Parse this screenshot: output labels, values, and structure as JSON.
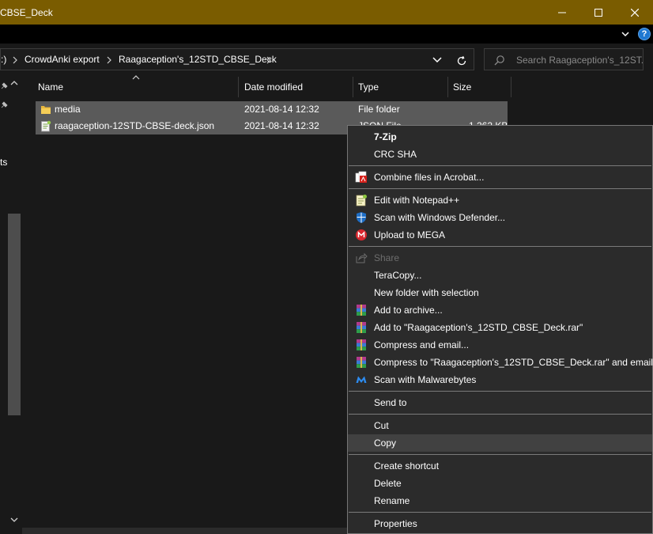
{
  "window": {
    "title": "CBSE_Deck"
  },
  "colors": {
    "titlebar": "#7a5c00",
    "background": "#191919",
    "selected_row": "#5a5a5a",
    "menu_bg": "#2b2b2b",
    "menu_highlight": "#414141",
    "help_blue": "#1f78d1"
  },
  "address": {
    "drive_fragment": ":)",
    "crumbs": [
      "CrowdAnki export",
      "Raagaception's_12STD_CBSE_Deck"
    ]
  },
  "search": {
    "placeholder": "Search Raagaception's_12ST..."
  },
  "nav": {
    "cut_text": "ts"
  },
  "columns": [
    "Name",
    "Date modified",
    "Type",
    "Size"
  ],
  "files": [
    {
      "name": "media",
      "date": "2021-08-14 12:32",
      "type": "File folder",
      "size": "",
      "icon": "folder-icon"
    },
    {
      "name": "raagaception-12STD-CBSE-deck.json",
      "date": "2021-08-14 12:32",
      "type": "JSON File",
      "size": "1,262 KB",
      "icon": "json-file-icon"
    }
  ],
  "context_menu": {
    "items": [
      {
        "label": "7-Zip",
        "icon": "",
        "bold": true
      },
      {
        "label": "CRC SHA",
        "icon": ""
      },
      {
        "label": "Combine files in Acrobat...",
        "icon": "acrobat-icon"
      },
      {
        "label": "Edit with Notepad++",
        "icon": "notepad-plus-plus-icon"
      },
      {
        "label": "Scan with Windows Defender...",
        "icon": "windows-defender-icon"
      },
      {
        "label": "Upload to MEGA",
        "icon": "mega-icon"
      },
      {
        "label": "Share",
        "icon": "share-icon",
        "disabled": true
      },
      {
        "label": "TeraCopy...",
        "icon": ""
      },
      {
        "label": "New folder with selection",
        "icon": ""
      },
      {
        "label": "Add to archive...",
        "icon": "winrar-icon"
      },
      {
        "label": "Add to \"Raagaception's_12STD_CBSE_Deck.rar\"",
        "icon": "winrar-icon"
      },
      {
        "label": "Compress and email...",
        "icon": "winrar-icon"
      },
      {
        "label": "Compress to \"Raagaception's_12STD_CBSE_Deck.rar\" and email",
        "icon": "winrar-icon"
      },
      {
        "label": "Scan with Malwarebytes",
        "icon": "malwarebytes-icon"
      },
      {
        "label": "Send to",
        "icon": ""
      },
      {
        "label": "Cut",
        "icon": ""
      },
      {
        "label": "Copy",
        "icon": "",
        "highlighted": true
      },
      {
        "label": "Create shortcut",
        "icon": ""
      },
      {
        "label": "Delete",
        "icon": ""
      },
      {
        "label": "Rename",
        "icon": ""
      },
      {
        "label": "Properties",
        "icon": ""
      }
    ]
  }
}
